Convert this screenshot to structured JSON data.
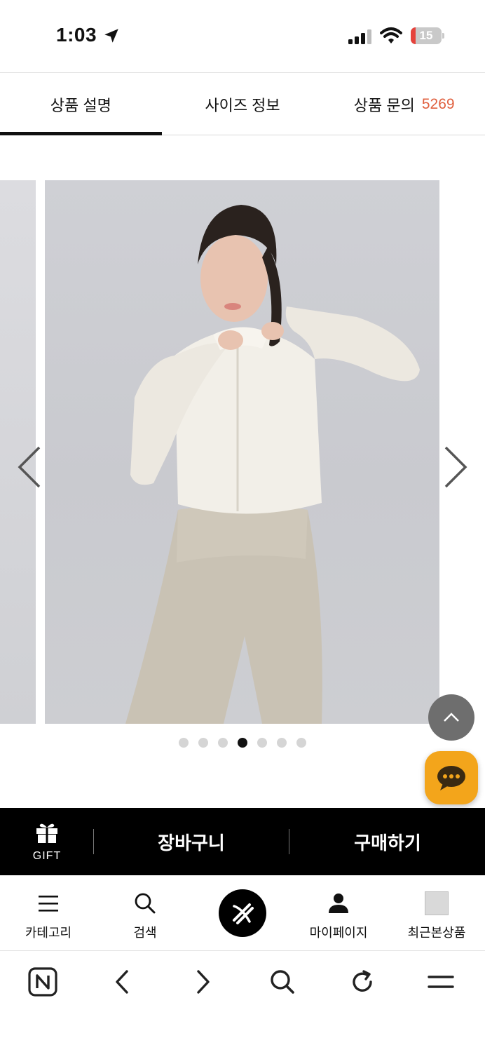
{
  "status_bar": {
    "time": "1:03",
    "battery_level": "15",
    "battery_color": "#e5423c"
  },
  "tabs": [
    {
      "label": "상품 설명",
      "active": true
    },
    {
      "label": "사이즈 정보",
      "active": false
    },
    {
      "label": "상품 문의",
      "count": "5269",
      "active": false
    }
  ],
  "carousel": {
    "image_subject": "model in cream zip-up cropped jacket and beige leggings",
    "slide_count": 7,
    "active_index": 3
  },
  "floating": {
    "scroll_top_icon": "chevron-up-icon",
    "chat_icon": "chat-bubble-icon",
    "chat_color": "#f3a51b"
  },
  "purchase_bar": {
    "gift_label": "GIFT",
    "cart_label": "장바구니",
    "buy_label": "구매하기"
  },
  "bottom_nav": {
    "category": "카테고리",
    "search": "검색",
    "mypage": "마이페이지",
    "recent": "최근본상품"
  },
  "browser_toolbar": {
    "icons": [
      "naver-home-icon",
      "back-icon",
      "forward-icon",
      "search-icon",
      "reload-icon",
      "menu-icon"
    ]
  }
}
